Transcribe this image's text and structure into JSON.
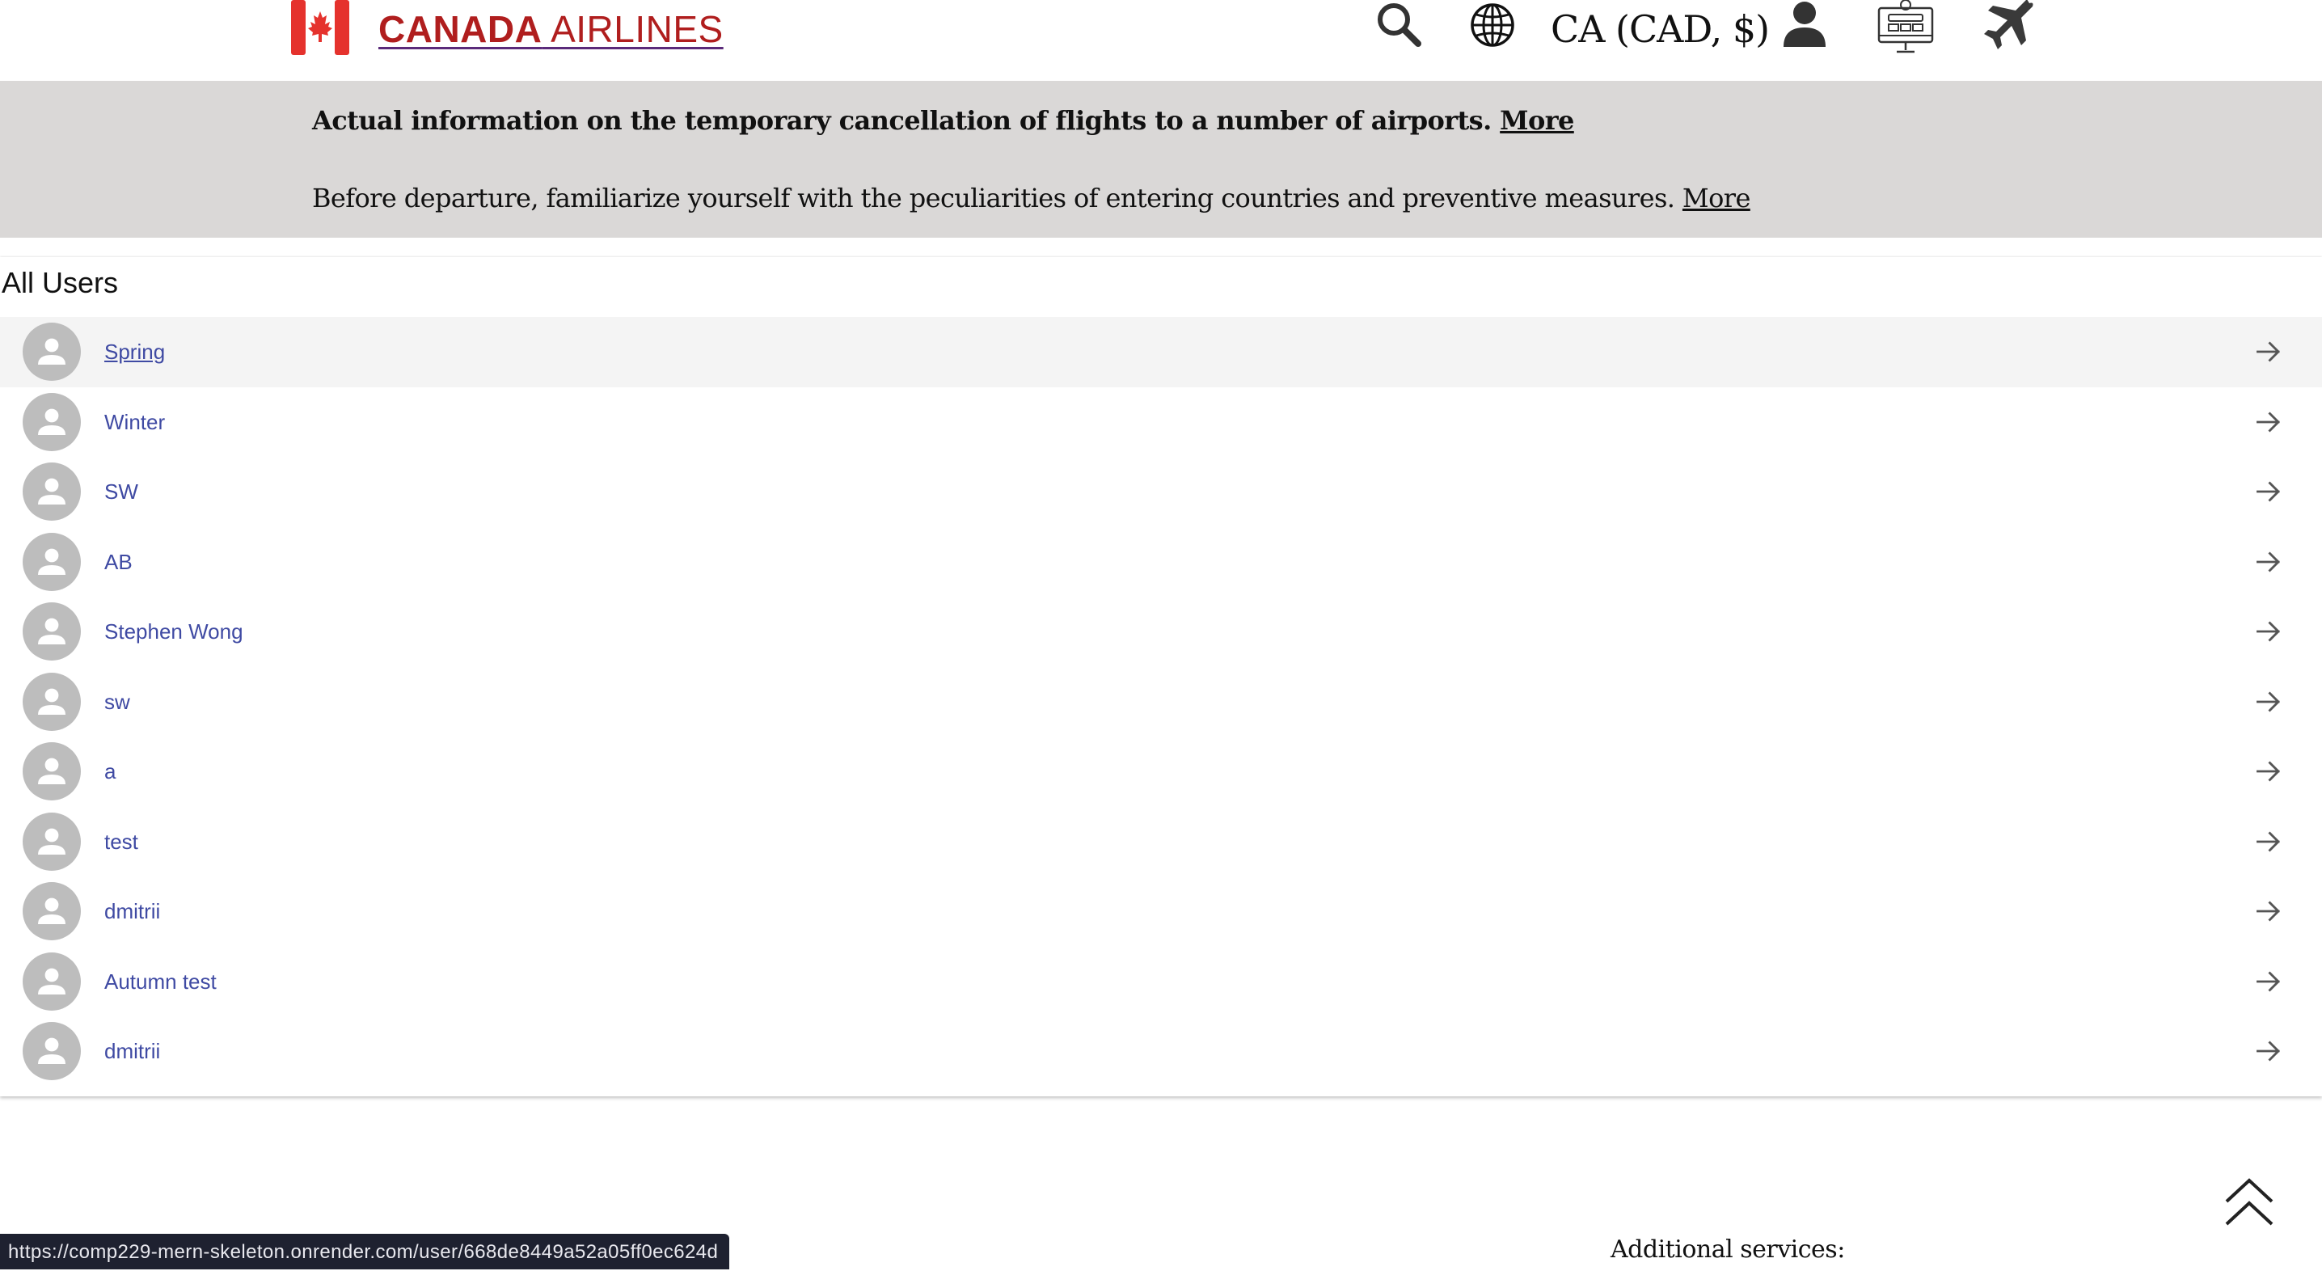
{
  "header": {
    "brand_part1": "CANADA",
    "brand_part2": " AIRLINES",
    "currency": "CA (CAD, $)",
    "icons": [
      "search-icon",
      "globe-icon",
      "user-icon",
      "online-checkin-icon",
      "flight-icon"
    ]
  },
  "notice": {
    "line1_text": "Actual information on the temporary cancellation of flights to a number of airports. ",
    "line1_link": "More",
    "line2_text": "Before departure, familiarize yourself with the peculiarities of entering countries and preventive measures. ",
    "line2_link": "More"
  },
  "users": {
    "title": "All Users",
    "items": [
      {
        "name": "Spring"
      },
      {
        "name": "Winter"
      },
      {
        "name": "SW"
      },
      {
        "name": "AB"
      },
      {
        "name": "Stephen Wong"
      },
      {
        "name": "sw"
      },
      {
        "name": "a"
      },
      {
        "name": "test"
      },
      {
        "name": "dmitrii"
      },
      {
        "name": "Autumn test"
      },
      {
        "name": "dmitrii"
      }
    ]
  },
  "footer": {
    "additional_services": "Additional services:"
  },
  "status_bar": {
    "url": "https://comp229-mern-skeleton.onrender.com/user/668de8449a52a05ff0ec624d"
  },
  "colors": {
    "brand_red": "#b01e1e",
    "banner_bg": "#dad8d7",
    "link_blue": "#3f4aa3",
    "avatar_gray": "#bdbdbd"
  }
}
